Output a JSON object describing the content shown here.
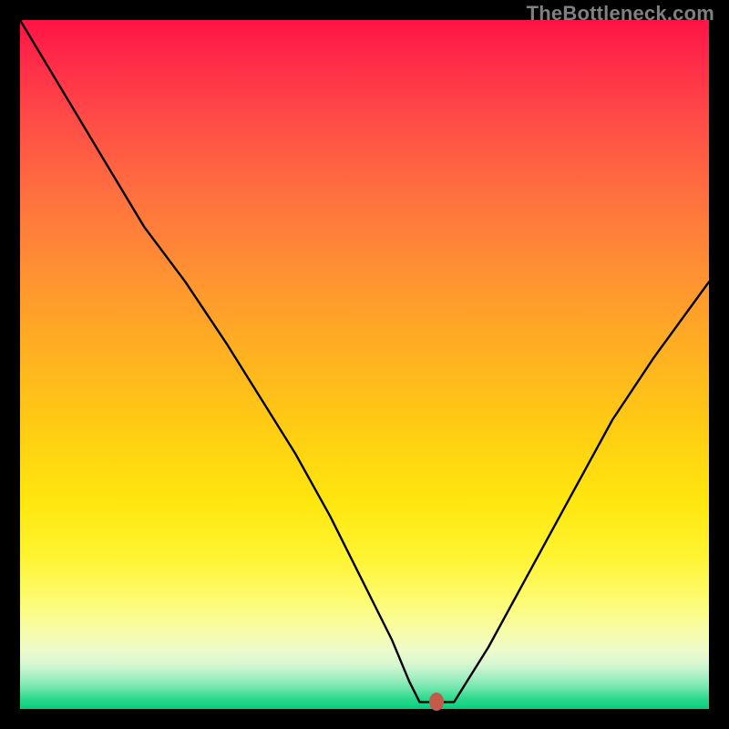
{
  "watermark": "TheBottleneck.com",
  "colors": {
    "frame": "#000000",
    "curve": "#000000",
    "marker": "#c65a4a"
  },
  "chart_data": {
    "type": "line",
    "title": "",
    "xlabel": "",
    "ylabel": "",
    "xlim": [
      0,
      100
    ],
    "ylim": [
      0,
      100
    ],
    "grid": false,
    "series": [
      {
        "name": "bottleneck-curve",
        "x": [
          0,
          6,
          12,
          18,
          24,
          30,
          35,
          40,
          45,
          50,
          54,
          56.5,
          58,
          60.5,
          63,
          68,
          74,
          80,
          86,
          92,
          100
        ],
        "values": [
          100,
          90,
          80,
          70,
          62,
          53,
          45,
          37,
          28,
          18,
          10,
          4,
          1,
          1,
          1,
          9,
          20,
          31,
          42,
          51,
          62
        ]
      }
    ],
    "annotations": [
      {
        "name": "min-marker",
        "x": 60.5,
        "y": 1
      }
    ],
    "note": "Values estimated from pixel positions; y=0 at bottom (green), y=100 at top (red). Curve minimum ≈ x 60.5."
  }
}
